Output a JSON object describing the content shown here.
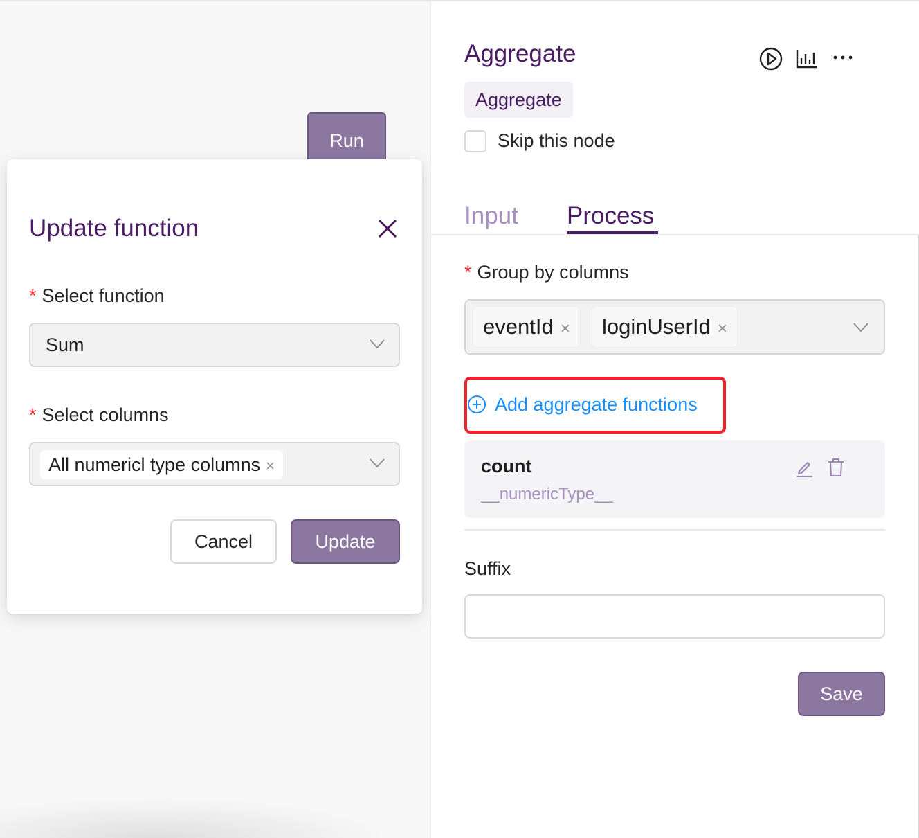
{
  "canvas": {
    "run_label": "Run"
  },
  "modal": {
    "title": "Update function",
    "required_mark": "*",
    "function_label": "Select function",
    "function_value": "Sum",
    "columns_label": "Select columns",
    "columns_tag": "All numericl type columns",
    "remove_glyph": "×",
    "cancel_label": "Cancel",
    "update_label": "Update"
  },
  "panel": {
    "title": "Aggregate",
    "type_tag": "Aggregate",
    "skip_label": "Skip this node",
    "skip_checked": false,
    "tabs": [
      {
        "label": "Input",
        "active": false
      },
      {
        "label": "Process",
        "active": true
      }
    ],
    "group_by_label": "Group by columns",
    "group_by_values": [
      "eventId",
      "loginUserId"
    ],
    "add_function_label": "Add aggregate functions",
    "functions": [
      {
        "name": "count",
        "columns": "__numericType__"
      }
    ],
    "suffix_label": "Suffix",
    "suffix_value": "",
    "save_label": "Save"
  },
  "colors": {
    "brand_purple": "#4a1c63",
    "button_purple": "#8c77a1",
    "link_blue": "#1890ff",
    "required_red": "#f5222d",
    "highlight_red": "#f5222d"
  },
  "icons": [
    "play-icon",
    "chart-icon",
    "more-icon",
    "close-icon",
    "chevron-down-icon",
    "plus-circle-icon",
    "edit-icon",
    "delete-icon"
  ]
}
